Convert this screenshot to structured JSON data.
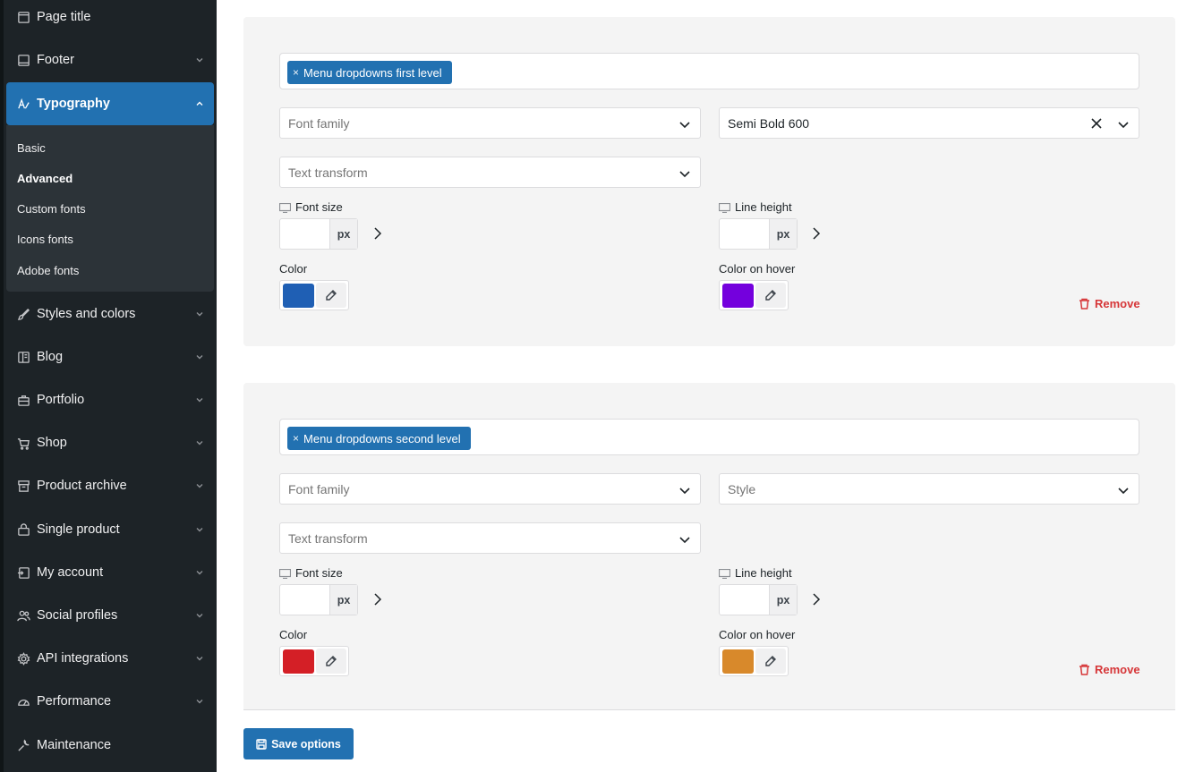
{
  "sidebar": {
    "items": [
      {
        "label": "Page title",
        "icon": "page-icon"
      },
      {
        "label": "Footer",
        "icon": "footer-icon"
      },
      {
        "label": "Typography",
        "icon": "typography-icon",
        "active": true
      },
      {
        "label": "Styles and colors",
        "icon": "brush-icon"
      },
      {
        "label": "Blog",
        "icon": "blog-icon"
      },
      {
        "label": "Portfolio",
        "icon": "briefcase-icon"
      },
      {
        "label": "Shop",
        "icon": "cart-icon"
      },
      {
        "label": "Product archive",
        "icon": "archive-icon"
      },
      {
        "label": "Single product",
        "icon": "bag-icon"
      },
      {
        "label": "My account",
        "icon": "account-icon"
      },
      {
        "label": "Social profiles",
        "icon": "users-icon"
      },
      {
        "label": "API integrations",
        "icon": "api-gear-icon"
      },
      {
        "label": "Performance",
        "icon": "gauge-icon"
      },
      {
        "label": "Maintenance",
        "icon": "wrench-icon"
      }
    ],
    "submenu": [
      "Basic",
      "Advanced",
      "Custom fonts",
      "Icons fonts",
      "Adobe fonts"
    ],
    "submenu_current": "Advanced"
  },
  "panels": [
    {
      "tag": "Menu dropdowns first level",
      "font_family_placeholder": "Font family",
      "style_value": "Semi Bold 600",
      "text_transform_placeholder": "Text transform",
      "font_size_label": "Font size",
      "line_height_label": "Line height",
      "unit": "px",
      "color_label": "Color",
      "color_hover_label": "Color on hover",
      "color": "#1f5fb4",
      "color_hover": "#7400dd",
      "remove_label": "Remove"
    },
    {
      "tag": "Menu dropdowns second level",
      "font_family_placeholder": "Font family",
      "style_placeholder": "Style",
      "text_transform_placeholder": "Text transform",
      "font_size_label": "Font size",
      "line_height_label": "Line height",
      "unit": "px",
      "color_label": "Color",
      "color_hover_label": "Color on hover",
      "color": "#d41f26",
      "color_hover": "#d8892b",
      "remove_label": "Remove"
    }
  ],
  "save_label": "Save options",
  "colors": {
    "accent": "#2271b1",
    "danger": "#d63638",
    "sidebar_bg": "#1d2327"
  }
}
